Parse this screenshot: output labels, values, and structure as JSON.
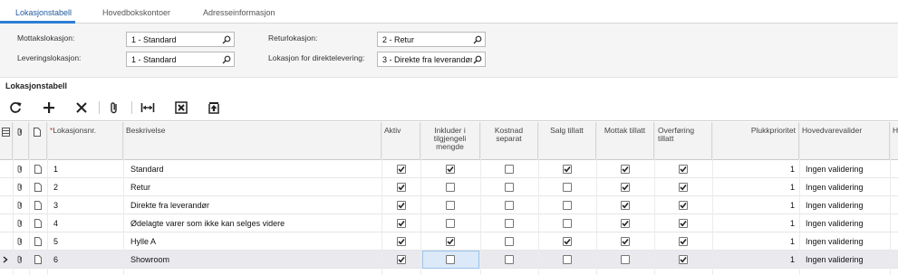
{
  "tabs": [
    "Lokasjonstabell",
    "Hovedbokskontoer",
    "Adresseinformasjon"
  ],
  "form": {
    "mottakslokasjon_label": "Mottakslokasjon:",
    "mottakslokasjon_value": "1 - Standard",
    "leveringslokasjon_label": "Leveringslokasjon:",
    "leveringslokasjon_value": "1 - Standard",
    "returlokasjon_label": "Returlokasjon:",
    "returlokasjon_value": "2 - Retur",
    "direktelevering_label": "Lokasjon for direktelevering:",
    "direktelevering_value": "3 - Direkte fra leverandør"
  },
  "section_title": "Lokasjonstabell",
  "toolbar": [
    "refresh-icon",
    "add-icon",
    "delete-icon",
    "attach-icon",
    "fit-columns-icon",
    "export-excel-icon",
    "upload-icon"
  ],
  "grid": {
    "headers": {
      "lokasjonsnr": "Lokasjonsnr.",
      "required_mark": "*",
      "beskrivelse": "Beskrivelse",
      "aktiv": "Aktiv",
      "inkluder": "Inkluder i tilgjengeli mengde",
      "kostnad": "Kostnad separat",
      "salg": "Salg tillatt",
      "mottak": "Mottak tillatt",
      "overforing": "Overføring tillatt",
      "plukk": "Plukkprioritet",
      "hovedvare": "Hovedvarevalider",
      "cut": "H"
    },
    "rows": [
      {
        "nr": "1",
        "beskrivelse": "Standard",
        "aktiv": true,
        "inkluder": true,
        "kostnad": false,
        "salg": true,
        "mottak": true,
        "overforing": true,
        "plukk": "1",
        "hovedvare": "Ingen validering"
      },
      {
        "nr": "2",
        "beskrivelse": "Retur",
        "aktiv": true,
        "inkluder": false,
        "kostnad": false,
        "salg": false,
        "mottak": true,
        "overforing": true,
        "plukk": "1",
        "hovedvare": "Ingen validering"
      },
      {
        "nr": "3",
        "beskrivelse": "Direkte fra leverandør",
        "aktiv": true,
        "inkluder": false,
        "kostnad": false,
        "salg": false,
        "mottak": true,
        "overforing": true,
        "plukk": "1",
        "hovedvare": "Ingen validering"
      },
      {
        "nr": "4",
        "beskrivelse": "Ødelagte varer som ikke kan selges videre",
        "aktiv": true,
        "inkluder": false,
        "kostnad": false,
        "salg": false,
        "mottak": true,
        "overforing": true,
        "plukk": "1",
        "hovedvare": "Ingen validering"
      },
      {
        "nr": "5",
        "beskrivelse": "Hylle A",
        "aktiv": true,
        "inkluder": true,
        "kostnad": false,
        "salg": true,
        "mottak": true,
        "overforing": true,
        "plukk": "1",
        "hovedvare": "Ingen validering"
      },
      {
        "nr": "6",
        "beskrivelse": "Showroom",
        "aktiv": true,
        "inkluder": false,
        "kostnad": false,
        "salg": false,
        "mottak": false,
        "overforing": true,
        "plukk": "1",
        "hovedvare": "Ingen validering"
      }
    ]
  }
}
